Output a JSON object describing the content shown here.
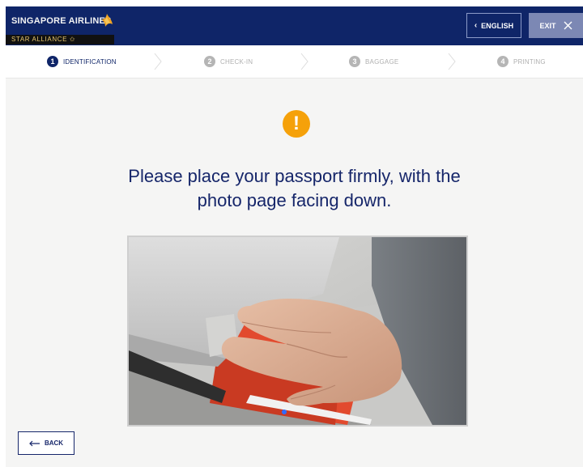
{
  "header": {
    "airline_name": "SINGAPORE AIRLINES",
    "alliance": "STAR ALLIANCE ✩",
    "language_button": "ENGLISH",
    "exit_button": "EXIT"
  },
  "steps": [
    {
      "number": "1",
      "label": "IDENTIFICATION",
      "state": "active"
    },
    {
      "number": "2",
      "label": "CHECK-IN",
      "state": "inactive"
    },
    {
      "number": "3",
      "label": "BAGGAGE",
      "state": "inactive"
    },
    {
      "number": "4",
      "label": "PRINTING",
      "state": "inactive"
    }
  ],
  "main": {
    "alert_glyph": "!",
    "instruction_line1": "Please place your passport firmly, with the",
    "instruction_line2": "photo page facing down."
  },
  "footer": {
    "back_button": "BACK"
  },
  "colors": {
    "brand_navy": "#0f2568",
    "warning": "#f5a10a",
    "background": "#f5f5f4",
    "exit_button_bg": "#7c88b4"
  }
}
